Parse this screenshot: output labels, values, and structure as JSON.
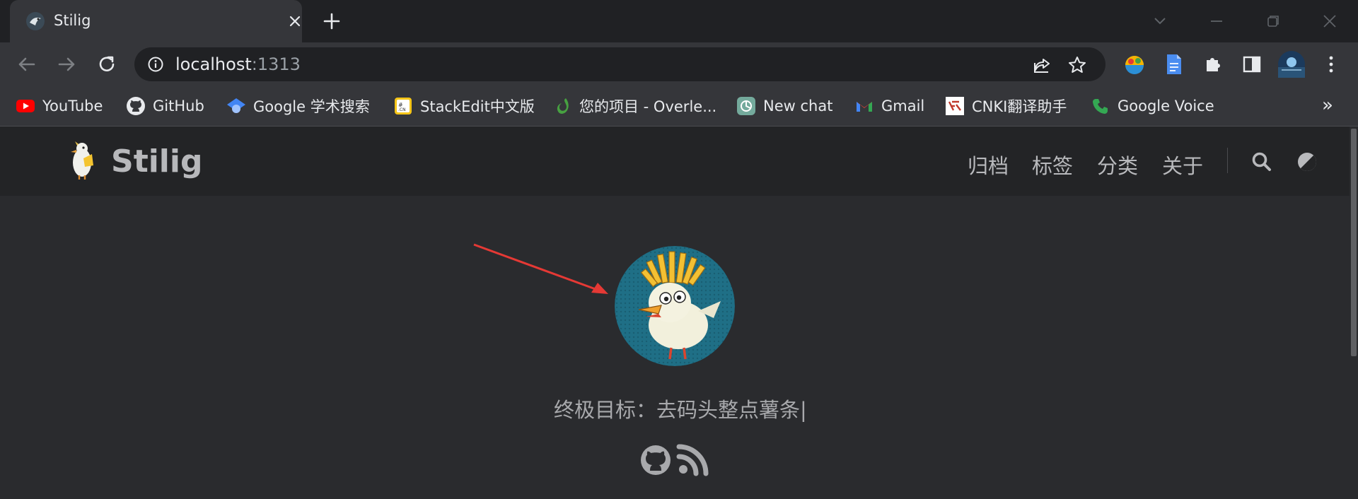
{
  "browser": {
    "tab": {
      "title": "Stilig"
    },
    "address": {
      "host": "localhost",
      "port": ":1313"
    },
    "bookmarks": [
      {
        "label": "YouTube",
        "icon": "youtube-icon"
      },
      {
        "label": "GitHub",
        "icon": "github-icon"
      },
      {
        "label": "Google 学术搜索",
        "icon": "google-scholar-icon"
      },
      {
        "label": "StackEdit中文版",
        "icon": "stackedit-icon"
      },
      {
        "label": "您的项目 - Overle...",
        "icon": "overleaf-icon"
      },
      {
        "label": "New chat",
        "icon": "chatgpt-icon"
      },
      {
        "label": "Gmail",
        "icon": "gmail-icon"
      },
      {
        "label": "CNKI翻译助手",
        "icon": "cnki-icon"
      },
      {
        "label": "Google Voice",
        "icon": "google-voice-icon"
      }
    ],
    "bookmarks_overflow": "»"
  },
  "site": {
    "name": "Stilig",
    "nav": [
      "归档",
      "标签",
      "分类",
      "关于"
    ],
    "subtitle": "终极目标：去码头整点薯条",
    "cursor": "|"
  },
  "colors": {
    "page_bg": "#2a2b2e",
    "header_bg": "#232426",
    "avatar_bg": "#1f6f86",
    "annotation_arrow": "#e53935"
  }
}
